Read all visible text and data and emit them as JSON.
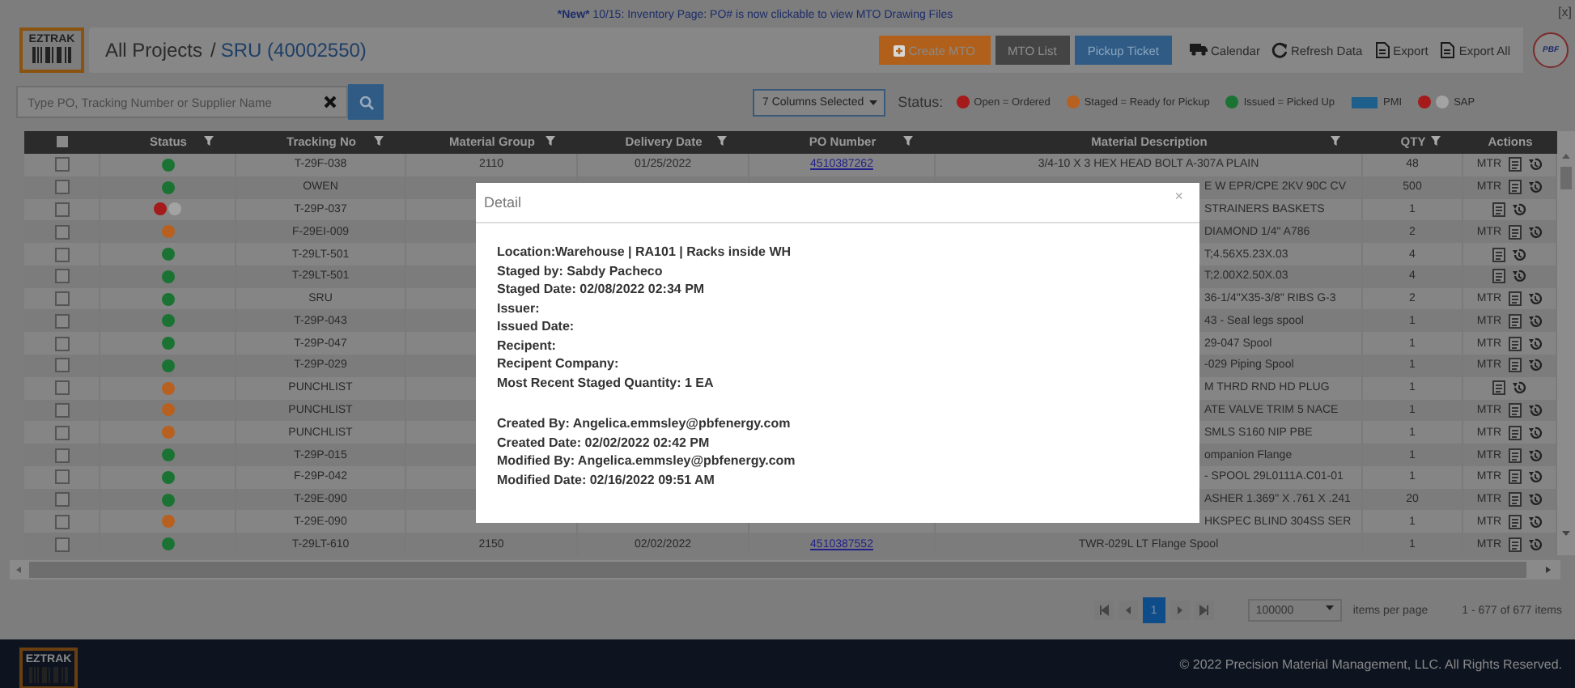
{
  "notice": {
    "badge": "*New*",
    "text": "10/15: Inventory Page: PO# is now clickable to view MTO Drawing Files"
  },
  "close_label": "[x]",
  "header": {
    "logo": "EZTRAK",
    "root": "All Projects",
    "separator": "/",
    "project": "SRU (40002550)",
    "brand": "PBF",
    "buttons": [
      {
        "label": "Create MTO",
        "kind": "orange"
      },
      {
        "label": "MTO List",
        "kind": "dark"
      },
      {
        "label": "Pickup Ticket",
        "kind": "blue"
      }
    ],
    "links": [
      {
        "label": "Calendar",
        "kind": "truck"
      },
      {
        "label": "Refresh Data",
        "kind": "refresh"
      },
      {
        "label": "Export",
        "kind": "file"
      },
      {
        "label": "Export All",
        "kind": "file"
      }
    ]
  },
  "toolbar": {
    "search": {
      "placeholder": "Type PO, Tracking Number or Supplier Name"
    },
    "columns": "7 Columns Selected",
    "status_label": "Status:",
    "legend": [
      {
        "kind": "dot",
        "color": "#a51a1a",
        "label": "Open = Ordered"
      },
      {
        "kind": "dot",
        "color": "#b8601f",
        "label": "Staged = Ready for Pickup"
      },
      {
        "kind": "dot",
        "color": "#1b7333",
        "label": "Issued = Picked Up"
      },
      {
        "kind": "swatch",
        "color": "#1f5f8c",
        "label": "PMI"
      },
      {
        "kind": "dots",
        "dots": [
          {
            "color": "#a51a1a"
          },
          {
            "color": "#a3a3a3"
          }
        ],
        "label": "SAP"
      }
    ]
  },
  "table": {
    "select_all_checked": false,
    "columns": [
      {
        "label": "Status",
        "filter": true
      },
      {
        "label": "Tracking No",
        "filter": true
      },
      {
        "label": "Material Group",
        "filter": true
      },
      {
        "label": "Delivery Date",
        "filter": true
      },
      {
        "label": "PO Number",
        "filter": true
      },
      {
        "label": "Material Description",
        "filter": true
      },
      {
        "label": "QTY",
        "filter": true
      },
      {
        "label": "Actions",
        "filter": false
      }
    ],
    "rows": [
      {
        "checked": false,
        "status": [
          {
            "color": "#1b7333"
          }
        ],
        "tracking": "T-29F-038",
        "material_group": "2110",
        "delivery_date": "01/25/2022",
        "po_number": "4510387262",
        "description": "3/4-10 X 3 HEX HEAD BOLT A-307A PLAIN",
        "qty": "48",
        "mtr": "MTR"
      },
      {
        "checked": false,
        "status": [
          {
            "color": "#1b7333"
          }
        ],
        "tracking": "OWEN",
        "description": "E W EPR/CPE 2KV 90C CV",
        "qty": "500",
        "mtr": "MTR"
      },
      {
        "checked": false,
        "status": [
          {
            "color": "#a51a1a"
          },
          {
            "color": "#a3a3a3"
          }
        ],
        "tracking": "T-29P-037",
        "description": "STRAINERS BASKETS",
        "qty": "1"
      },
      {
        "checked": false,
        "status": [
          {
            "color": "#b8601f"
          }
        ],
        "tracking": "F-29EI-009",
        "description": "DIAMOND 1/4\" A786",
        "qty": "2",
        "mtr": "MTR"
      },
      {
        "checked": false,
        "status": [
          {
            "color": "#1b7333"
          }
        ],
        "tracking": "T-29LT-501",
        "description": "T;4.56X5.23X.03",
        "qty": "4"
      },
      {
        "checked": false,
        "status": [
          {
            "color": "#1b7333"
          }
        ],
        "tracking": "T-29LT-501",
        "description": "T;2.00X2.50X.03",
        "qty": "4"
      },
      {
        "checked": false,
        "status": [
          {
            "color": "#1b7333"
          }
        ],
        "tracking": "SRU",
        "description": "36-1/4\"X35-3/8\" RIBS G-3",
        "qty": "2",
        "mtr": "MTR"
      },
      {
        "checked": false,
        "status": [
          {
            "color": "#1b7333"
          }
        ],
        "tracking": "T-29P-043",
        "description": "43 - Seal legs spool",
        "qty": "1",
        "mtr": "MTR"
      },
      {
        "checked": false,
        "status": [
          {
            "color": "#1b7333"
          }
        ],
        "tracking": "T-29P-047",
        "description": "29-047 Spool",
        "qty": "1",
        "mtr": "MTR"
      },
      {
        "checked": false,
        "status": [
          {
            "color": "#1b7333"
          }
        ],
        "tracking": "T-29P-029",
        "description": "-029 Piping Spool",
        "qty": "1",
        "mtr": "MTR"
      },
      {
        "checked": false,
        "status": [
          {
            "color": "#b8601f"
          }
        ],
        "tracking": "PUNCHLIST",
        "description": "M THRD RND HD PLUG",
        "qty": "1"
      },
      {
        "checked": false,
        "status": [
          {
            "color": "#b8601f"
          }
        ],
        "tracking": "PUNCHLIST",
        "description": "ATE VALVE TRIM 5 NACE",
        "qty": "1",
        "mtr": "MTR"
      },
      {
        "checked": false,
        "status": [
          {
            "color": "#b8601f"
          }
        ],
        "tracking": "PUNCHLIST",
        "description": "SMLS S160 NIP PBE",
        "qty": "1",
        "mtr": "MTR"
      },
      {
        "checked": false,
        "status": [
          {
            "color": "#1b7333"
          }
        ],
        "tracking": "T-29P-015",
        "description": "ompanion Flange",
        "qty": "1",
        "mtr": "MTR"
      },
      {
        "checked": false,
        "status": [
          {
            "color": "#1b7333"
          }
        ],
        "tracking": "F-29P-042",
        "description": "- SPOOL 29L0111A.C01-01",
        "qty": "1",
        "mtr": "MTR"
      },
      {
        "checked": false,
        "status": [
          {
            "color": "#1b7333"
          }
        ],
        "tracking": "T-29E-090",
        "description": "ASHER 1.369\" X .761 X .241",
        "qty": "20",
        "mtr": "MTR"
      },
      {
        "checked": false,
        "status": [
          {
            "color": "#b8601f"
          }
        ],
        "tracking": "T-29E-090",
        "description": "HKSPEC BLIND 304SS SER",
        "qty": "1",
        "mtr": "MTR"
      },
      {
        "checked": false,
        "status": [
          {
            "color": "#1b7333"
          }
        ],
        "tracking": "T-29LT-610",
        "material_group": "2150",
        "delivery_date": "02/02/2022",
        "po_number": "4510387552",
        "description": "TWR-029L LT Flange Spool",
        "qty": "1",
        "mtr": "MTR"
      }
    ]
  },
  "pager": {
    "pages": [
      {
        "label": "1",
        "selected": true
      }
    ],
    "page_size": "100000",
    "per_page_label": "items per page",
    "summary": "1 - 677 of 677 items"
  },
  "footer": {
    "logo": "EZTRAK",
    "copyright": "© 2022 Precision Material Management, LLC. All Rights Reserved."
  },
  "modal": {
    "title": "Detail",
    "close": "×",
    "groups": [
      [
        "Location:Warehouse | RA101 | Racks inside WH",
        "Staged by: Sabdy Pacheco",
        "Staged Date: 02/08/2022 02:34 PM",
        "Issuer:",
        "Issued Date:",
        "Recipent:",
        "Recipent Company:",
        "Most Recent Staged Quantity: 1 EA"
      ],
      [
        "Created By: Angelica.emmsley@pbfenergy.com",
        "Created Date: 02/02/2022 02:42 PM",
        "Modified By: Angelica.emmsley@pbfenergy.com",
        "Modified Date: 02/16/2022 09:51 AM"
      ]
    ]
  }
}
